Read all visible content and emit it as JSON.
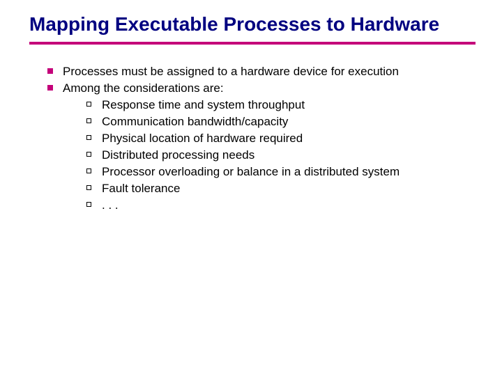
{
  "colors": {
    "title": "#000080",
    "accent": "#c4007a"
  },
  "title": "Mapping Executable Processes to Hardware",
  "bullets": {
    "level1": [
      "Processes must be assigned to a hardware device for execution",
      "Among the considerations are:"
    ],
    "level2": [
      "Response time and system throughput",
      "Communication bandwidth/capacity",
      "Physical location of hardware required",
      "Distributed processing needs",
      "Processor overloading or balance in a distributed system",
      "Fault tolerance",
      ". . ."
    ]
  }
}
